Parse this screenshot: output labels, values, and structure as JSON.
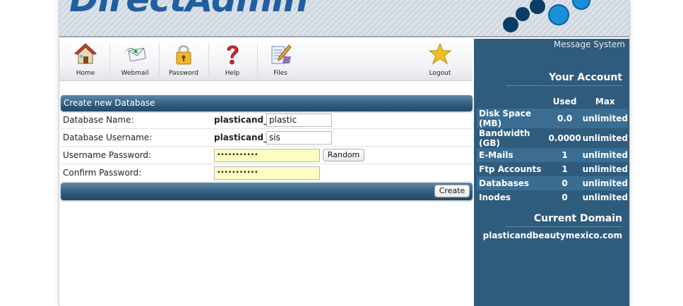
{
  "header": {
    "logo_text": "DirectAdmin"
  },
  "toolbar": {
    "items": [
      {
        "label": "Home",
        "icon": "home-icon"
      },
      {
        "label": "Webmail",
        "icon": "webmail-icon"
      },
      {
        "label": "Password",
        "icon": "lock-icon"
      },
      {
        "label": "Help",
        "icon": "help-icon"
      },
      {
        "label": "Files",
        "icon": "files-icon"
      },
      {
        "label": "Logout",
        "icon": "star-icon"
      }
    ]
  },
  "form": {
    "title": "Create new Database",
    "db_name_label": "Database Name:",
    "db_name_prefix": "plasticand_",
    "db_name_value": "plastic",
    "db_user_label": "Database Username:",
    "db_user_prefix": "plasticand_",
    "db_user_value": "sis",
    "password_label": "Username Password:",
    "password_value": "•••••••••••",
    "random_label": "Random",
    "confirm_label": "Confirm Password:",
    "confirm_value": "•••••••••••",
    "create_label": "Create"
  },
  "sidebar": {
    "message_system": "Message System",
    "account_title": "Your Account",
    "col_used": "Used",
    "col_max": "Max",
    "rows": [
      {
        "label": "Disk Space (MB)",
        "used": "0.0",
        "max": "unlimited"
      },
      {
        "label": "Bandwidth (GB)",
        "used": "0.0000",
        "max": "unlimited"
      },
      {
        "label": "E-Mails",
        "used": "1",
        "max": "unlimited"
      },
      {
        "label": "Ftp Accounts",
        "used": "1",
        "max": "unlimited"
      },
      {
        "label": "Databases",
        "used": "0",
        "max": "unlimited"
      },
      {
        "label": "Inodes",
        "used": "0",
        "max": "unlimited"
      }
    ],
    "domain_title": "Current Domain",
    "domain_name": "plasticandbeautymexico.com"
  },
  "colors": {
    "sidebar_bg": "#2f5b7d",
    "accent": "#1f5fa0",
    "password_bg": "#fdfdc2"
  }
}
